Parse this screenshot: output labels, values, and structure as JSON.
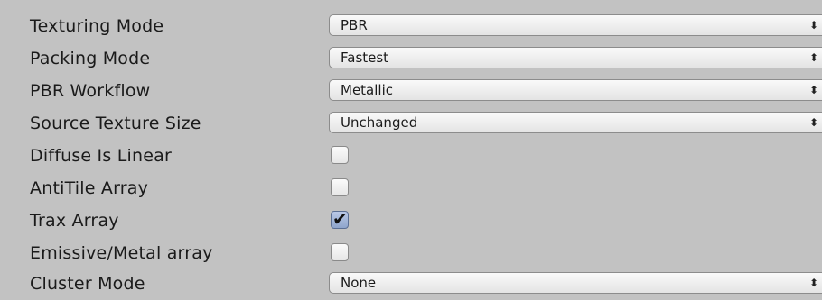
{
  "settings": {
    "texturing_mode": {
      "label": "Texturing Mode",
      "value": "PBR"
    },
    "packing_mode": {
      "label": "Packing Mode",
      "value": "Fastest"
    },
    "pbr_workflow": {
      "label": "PBR Workflow",
      "value": "Metallic"
    },
    "source_texture_size": {
      "label": "Source Texture Size",
      "value": "Unchanged"
    },
    "diffuse_is_linear": {
      "label": "Diffuse Is Linear",
      "checked": false
    },
    "antitile_array": {
      "label": "AntiTile Array",
      "checked": false
    },
    "trax_array": {
      "label": "Trax Array",
      "checked": true
    },
    "emissive_metal_array": {
      "label": "Emissive/Metal array",
      "checked": false
    },
    "cluster_mode": {
      "label": "Cluster Mode",
      "value": "None"
    }
  },
  "icons": {
    "dropdown_arrow": "up-down-arrows-icon",
    "check": "checkmark-icon"
  },
  "colors": {
    "panel_background": "#c2c2c2",
    "checkbox_checked": "#9fb2d6"
  }
}
